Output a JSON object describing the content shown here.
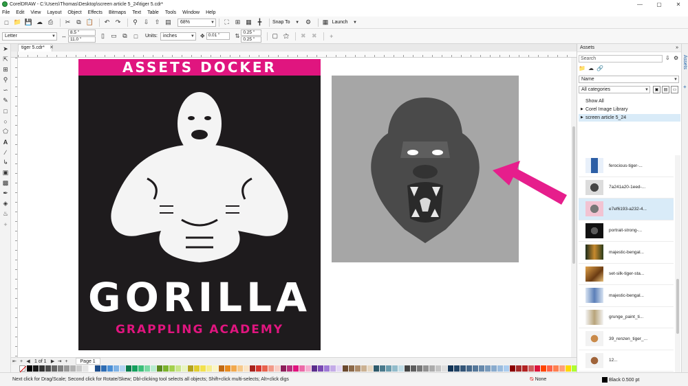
{
  "window": {
    "title": "CorelDRAW - C:\\Users\\Thomas\\Desktop\\screen article 5_24\\tiger 5.cdr*"
  },
  "menu": [
    "File",
    "Edit",
    "View",
    "Layout",
    "Object",
    "Effects",
    "Bitmaps",
    "Text",
    "Table",
    "Tools",
    "Window",
    "Help"
  ],
  "toolbar": {
    "zoom": "68%",
    "snap_to": "Snap To",
    "launch": "Launch"
  },
  "propbar": {
    "paper": "Letter",
    "width": "8.5 \"",
    "height": "11.0 \"",
    "units_label": "Units:",
    "units": "inches",
    "nudge": "0.01 \"",
    "dup_x": "0.25 \"",
    "dup_y": "0.25 \""
  },
  "doc_tab": "tiger 5.cdr*",
  "poster": {
    "header": "ASSETS DOCKER",
    "main": "GORILLA",
    "sub": "GRAPPLING ACADEMY"
  },
  "page_nav": {
    "counter": "1 of 1",
    "page_tab": "Page 1"
  },
  "docker": {
    "title": "Assets",
    "search_placeholder": "Search",
    "sort": "Name",
    "category": "All categories",
    "libraries": [
      "Show All",
      "Corel Image Library",
      "screen article 5_24"
    ],
    "assets": [
      "ferocious-tiger-...",
      "7a241a20-1eed-...",
      "e7ef6193-a232-4...",
      "portrait-strong-...",
      "majestic-bengal...",
      "set-silk-tiger-sta...",
      "majestic-bengal...",
      "grunge_paint_ti...",
      "39_renzen_tiger_...",
      "12..."
    ],
    "selected_index": 2,
    "side_tab": "Assets"
  },
  "status": {
    "hint": "Next click for Drag/Scale; Second click for Rotate/Skew; Dbl-clicking tool selects all objects; Shift+click multi-selects; Alt+click digs",
    "fill": "None",
    "outline": "Black  0.500 pt"
  },
  "colors": {
    "accent_pink": "#e0157f",
    "poster_bg": "#1e1b1d",
    "artboard_grey": "#a6a6a6",
    "selection": "#d9ebf8"
  },
  "palette": [
    "#000000",
    "#1a1a1a",
    "#333333",
    "#4d4d4d",
    "#666666",
    "#808080",
    "#999999",
    "#b3b3b3",
    "#cccccc",
    "#e6e6e6",
    "#ffffff",
    "#1e4e8c",
    "#2e6db4",
    "#4a8fd6",
    "#7fb2e5",
    "#b3d4f2",
    "#0a7a4a",
    "#16a05f",
    "#3cbf7a",
    "#7ad9a4",
    "#b8ecd0",
    "#5a8a1e",
    "#7cb32e",
    "#a3d04e",
    "#c9e68a",
    "#e8f5c0",
    "#b3a31e",
    "#e0cc2e",
    "#f2e14e",
    "#f7ee8f",
    "#fbf6c6",
    "#c26a14",
    "#e88a1e",
    "#f2a94e",
    "#f7c98c",
    "#fbe4c5",
    "#a8241e",
    "#d6362e",
    "#e8624e",
    "#f29a8a",
    "#f9cdc4",
    "#8c1e5a",
    "#b82e7c",
    "#e0157f",
    "#ec6aa8",
    "#f5acd0",
    "#5a2e8c",
    "#7a4ab4",
    "#9f7ad6",
    "#c4abe8",
    "#e3d6f5",
    "#6b4a2e",
    "#8c6a4a",
    "#ad8c6a",
    "#cbb192",
    "#e6d6c0",
    "#2e5a6b",
    "#4a7a8c",
    "#6a9cad",
    "#92bccb",
    "#c0dce6",
    "#444444",
    "#5e5e5e",
    "#777777",
    "#919191",
    "#ababab",
    "#c4c4c4",
    "#dedede",
    "#123456",
    "#234567",
    "#345678",
    "#456789",
    "#56789a",
    "#6789ab",
    "#789abc",
    "#89abcd",
    "#9abcde",
    "#abcdef",
    "#8b0000",
    "#a52a2a",
    "#b22222",
    "#cd5c5c",
    "#dc143c",
    "#ff4500",
    "#ff6347",
    "#ff7f50",
    "#ffa07a",
    "#ffd700",
    "#adff2f",
    "#7fff00",
    "#00fa9a",
    "#00ced1",
    "#1e90ff",
    "#4169e1",
    "#6a5acd",
    "#8a2be2",
    "#9932cc",
    "#c71585",
    "#db7093"
  ]
}
